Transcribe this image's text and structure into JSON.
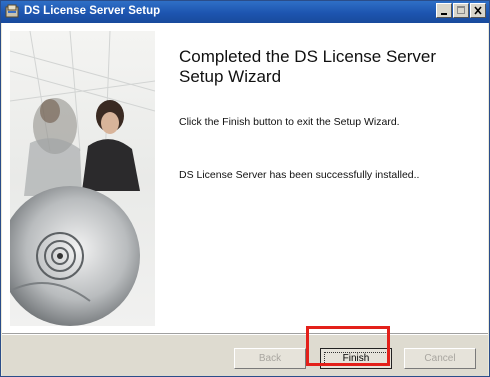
{
  "window": {
    "title": "DS License Server Setup",
    "minimize_label": "_",
    "maximize_label": "□",
    "close_label": "×"
  },
  "main": {
    "heading": "Completed the DS License Server Setup Wizard",
    "message_finish": "Click the Finish button to exit the Setup Wizard.",
    "message_installed": "DS License Server has been successfully installed.."
  },
  "buttons": {
    "back": "Back",
    "finish": "Finish",
    "cancel": "Cancel"
  },
  "colors": {
    "titlebar": "#1d55b0",
    "highlight": "#e3201a"
  }
}
